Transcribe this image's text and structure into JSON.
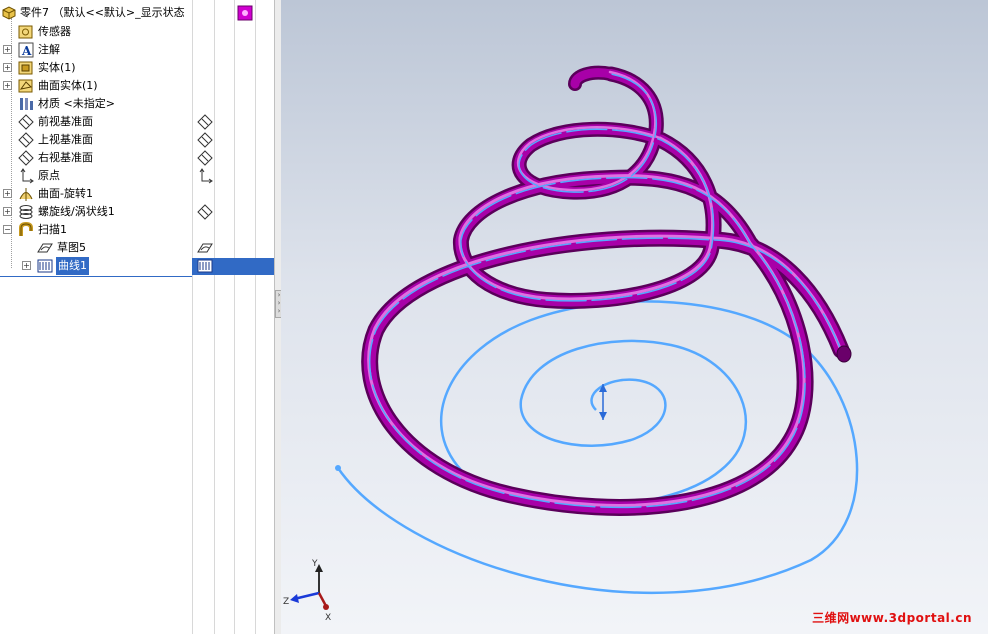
{
  "tree": {
    "root_label": "零件7  （默认<<默认>_显示状态",
    "items": [
      {
        "label": "传感器",
        "icon": "sensor-icon",
        "expandable": false
      },
      {
        "label": "注解",
        "icon": "annotation-icon",
        "expandable": true
      },
      {
        "label": "实体(1)",
        "icon": "solid-body-icon",
        "expandable": true
      },
      {
        "label": "曲面实体(1)",
        "icon": "surface-body-icon",
        "expandable": true
      },
      {
        "label": "材质 <未指定>",
        "icon": "material-icon",
        "expandable": false
      },
      {
        "label": "前视基准面",
        "icon": "plane-icon",
        "expandable": false
      },
      {
        "label": "上视基准面",
        "icon": "plane-icon",
        "expandable": false
      },
      {
        "label": "右视基准面",
        "icon": "plane-icon",
        "expandable": false
      },
      {
        "label": "原点",
        "icon": "origin-icon",
        "expandable": false
      },
      {
        "label": "曲面-旋转1",
        "icon": "revolve-surface-icon",
        "expandable": true
      },
      {
        "label": "螺旋线/涡状线1",
        "icon": "helix-icon",
        "expandable": true
      },
      {
        "label": "扫描1",
        "icon": "sweep-icon",
        "expandable": true
      },
      {
        "label": "草图5",
        "icon": "sketch-icon",
        "expandable": false
      },
      {
        "label": "曲线1",
        "icon": "curve-icon",
        "expandable": true,
        "selected": true
      }
    ]
  },
  "viewport": {
    "model": "conical-spring-sweep",
    "spring_color": "#a800a8",
    "path_color": "#55a8ff",
    "background_top": "#bcc6d6",
    "background_bottom": "#f2f4f8",
    "triad": {
      "z_label": "Z",
      "y_label": "Y",
      "x_label": "X"
    }
  },
  "watermark": "三维网www.3dportal.cn",
  "colors": {
    "selection": "#316ac5",
    "watermark": "#e01010"
  }
}
